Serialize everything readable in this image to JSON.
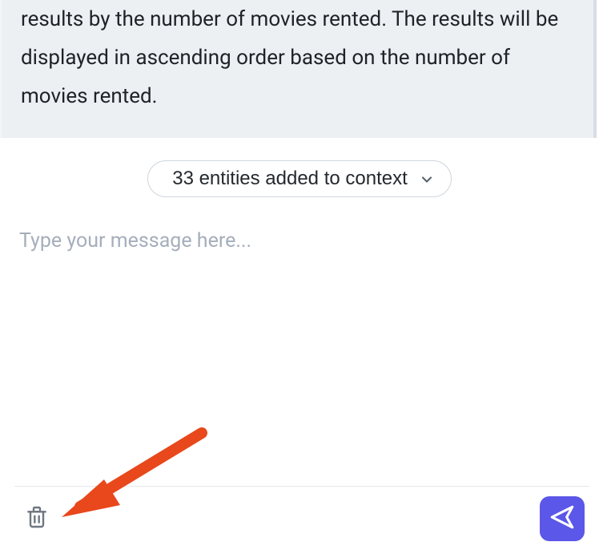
{
  "response": {
    "text": "results by the number of movies rented. The results will be displayed in ascending order based on the number of movies rented."
  },
  "context_pill": {
    "label": "33 entities added to context"
  },
  "input": {
    "placeholder": "Type your message here..."
  },
  "icons": {
    "trash": "trash-icon",
    "send": "send-icon",
    "chevron": "chevron-down-icon"
  },
  "colors": {
    "accent": "#5b57e8",
    "annotation": "#e8481b"
  }
}
